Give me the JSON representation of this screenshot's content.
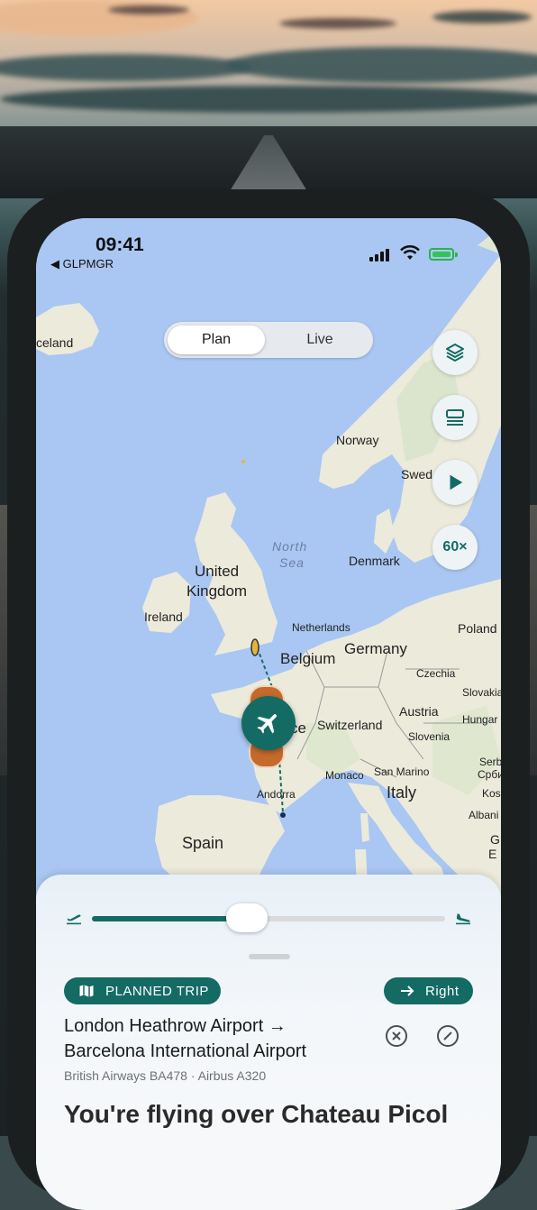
{
  "status_bar": {
    "time": "09:41",
    "back_app": "◀ GLPMGR"
  },
  "mode_toggle": {
    "options": [
      "Plan",
      "Live"
    ],
    "selected": "Plan"
  },
  "map_controls": {
    "speed": "60×",
    "icons": [
      "layers-icon",
      "list-icon",
      "play-icon"
    ]
  },
  "map_labels": {
    "iceland": "celand",
    "norway": "Norway",
    "sweden": "Swed",
    "north_sea_1": "North",
    "north_sea_2": "Sea",
    "denmark": "Denmark",
    "uk_1": "United",
    "uk_2": "Kingdom",
    "ireland": "Ireland",
    "netherlands": "Netherlands",
    "poland": "Poland",
    "belgium": "Belgium",
    "germany": "Germany",
    "czechia": "Czechia",
    "slovakia": "Slovakia",
    "austria": "Austria",
    "hungary": "Hungar",
    "france": "ce",
    "switzerland": "Switzerland",
    "slovenia": "Slovenia",
    "serbia_1": "Serb",
    "serbia_2": "Србиј",
    "monaco": "Monaco",
    "san_marino": "San Marino",
    "kosovo": "Kos",
    "andorra": "Andorra",
    "italy": "Italy",
    "albania": "Albani",
    "spain": "Spain",
    "greece_1": "G",
    "greece_2": "Ε"
  },
  "flight_progress": 0.44,
  "trip": {
    "badge": "PLANNED TRIP",
    "side_label": "Right",
    "route_line1": "London Heathrow Airport →",
    "route_line2": "Barcelona International Airport",
    "details": "British Airways BA478 · Airbus A320",
    "flying_over": "You're flying over Chateau Picol"
  },
  "colors": {
    "accent": "#136b64",
    "land": "#efeddf",
    "sea": "#a9c7f2",
    "pin": "#c46a2c"
  }
}
